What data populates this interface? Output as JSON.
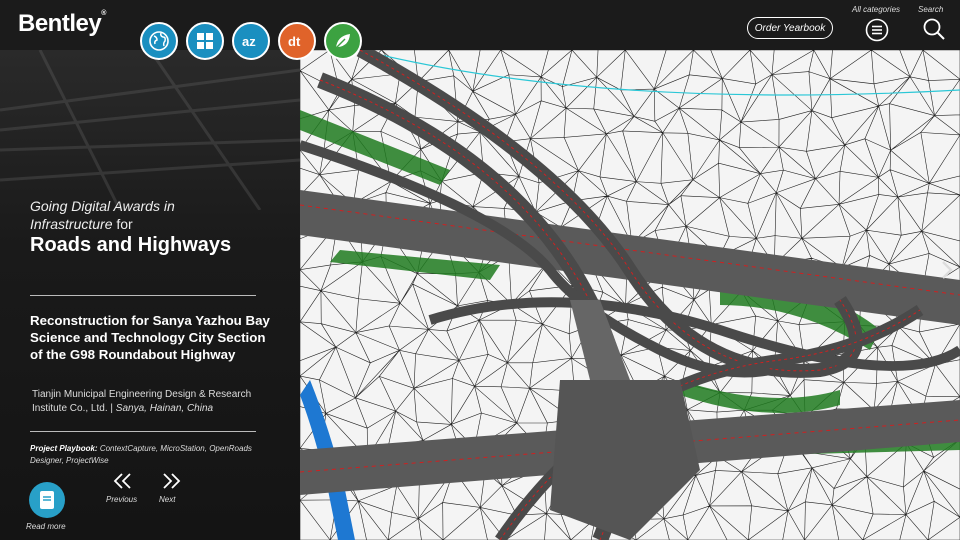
{
  "header": {
    "brand": "Bentley",
    "brand_mark": "®",
    "order_button": "Order Yearbook",
    "categories_label": "All categories",
    "search_label": "Search"
  },
  "nav_icons": [
    {
      "name": "globe-icon",
      "color": "#1a8fc0"
    },
    {
      "name": "grid-icon",
      "color": "#1a8fc0"
    },
    {
      "name": "az-icon",
      "color": "#1a8fc0"
    },
    {
      "name": "dt-icon",
      "color": "#e0632a"
    },
    {
      "name": "leaf-icon",
      "color": "#3ca241"
    }
  ],
  "panel": {
    "award_prefix": "Going Digital Awards in Infrastructure",
    "award_for": "for",
    "category": "Roads and Highways",
    "project": "Reconstruction for Sanya Yazhou Bay Science and Technology City Section of the G98 Roundabout Highway",
    "organization": "Tianjin Municipal Engineering Design & Research Institute Co., Ltd.",
    "separator": "|",
    "location": "Sanya, Hainan, China",
    "playbook_label": "Project Playbook:",
    "playbook_items": "ContextCapture, MicroStation, OpenRoads Designer, ProjectWise",
    "read_more": "Read more",
    "previous": "Previous",
    "next": "Next"
  },
  "colors": {
    "accent_blue": "#28a0c8",
    "road_grey": "#5a5a5a",
    "embankment_green": "#1f7a1f",
    "river_blue": "#1e78d2",
    "centerline_red": "#d02020"
  }
}
